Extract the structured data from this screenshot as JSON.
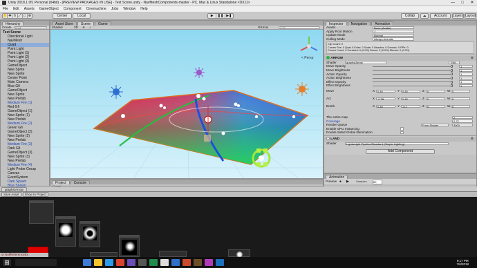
{
  "window": {
    "title": "Unity 2018.1.0f1 Personal (64bit) - [PREVIEW PACKAGES IN USE] - Test Scene.unity - NavMeshComponents-master - PC, Mac & Linux Standalone <DX11>",
    "minimize": "—",
    "maximize": "□",
    "close": "✕"
  },
  "menu": [
    "File",
    "Edit",
    "Assets",
    "GameObject",
    "Component",
    "Cinemachine",
    "Jobs",
    "Window",
    "Help"
  ],
  "toolbar": {
    "pivot": "Center",
    "space": "Local",
    "collab": "Collab",
    "account": "Account",
    "layers": "Layers",
    "layout": "Layout"
  },
  "hierarchy": {
    "tab": "Hierarchy",
    "create": "Create",
    "search_placeholder": "Q·All",
    "items": [
      {
        "label": "Test Scene",
        "kind": "scene"
      },
      {
        "label": "Directional Light",
        "kind": "normal"
      },
      {
        "label": "NavMesh",
        "kind": "normal"
      },
      {
        "label": "Quad",
        "kind": "selected"
      },
      {
        "label": "Point Light",
        "kind": "normal"
      },
      {
        "label": "Point Light (1)",
        "kind": "normal"
      },
      {
        "label": "Point Light (2)",
        "kind": "normal"
      },
      {
        "label": "Point Light (3)",
        "kind": "normal"
      },
      {
        "label": "GameObject",
        "kind": "normal"
      },
      {
        "label": "New Sprite",
        "kind": "normal"
      },
      {
        "label": "New Sprite",
        "kind": "normal"
      },
      {
        "label": "Center Point",
        "kind": "normal"
      },
      {
        "label": "Main Camera",
        "kind": "normal"
      },
      {
        "label": "Blue Gfi",
        "kind": "normal"
      },
      {
        "label": "GameObject",
        "kind": "normal"
      },
      {
        "label": "New Sprite",
        "kind": "normal"
      },
      {
        "label": "New Prefab",
        "kind": "normal"
      },
      {
        "label": "Medium Fire (1)",
        "kind": "prefab"
      },
      {
        "label": "Red Gfi",
        "kind": "normal"
      },
      {
        "label": "GameObject (1)",
        "kind": "normal"
      },
      {
        "label": "New Sprite (1)",
        "kind": "normal"
      },
      {
        "label": "New Prefab",
        "kind": "normal"
      },
      {
        "label": "Medium Fire (2)",
        "kind": "prefab"
      },
      {
        "label": "Green Gfi",
        "kind": "normal"
      },
      {
        "label": "GameObject (2)",
        "kind": "normal"
      },
      {
        "label": "New Sprite (2)",
        "kind": "normal"
      },
      {
        "label": "New Prefab",
        "kind": "normal"
      },
      {
        "label": "Medium Fire (3)",
        "kind": "prefab"
      },
      {
        "label": "Dark Gfi",
        "kind": "normal"
      },
      {
        "label": "GameObject (3)",
        "kind": "normal"
      },
      {
        "label": "New Sprite (3)",
        "kind": "normal"
      },
      {
        "label": "New Prefab",
        "kind": "normal"
      },
      {
        "label": "Medium Fire (4)",
        "kind": "prefab"
      },
      {
        "label": "Light Probe Group",
        "kind": "normal"
      },
      {
        "label": "Canvas",
        "kind": "normal"
      },
      {
        "label": "EventSystem",
        "kind": "normal"
      },
      {
        "label": "Dark Spawn",
        "kind": "blue"
      },
      {
        "label": "Blue Spawn",
        "kind": "blue"
      },
      {
        "label": "Green Spawn",
        "kind": "blue"
      },
      {
        "label": "Red Spawn",
        "kind": "blue"
      }
    ]
  },
  "scene": {
    "tabs": [
      "Asset Store",
      "Scene",
      "Game"
    ],
    "shading": "Shaded",
    "mode_2d": "2D",
    "gizmos": "Gizmos",
    "search_placeholder": "Q·All",
    "persp": "< Persp"
  },
  "inspector": {
    "tabs": [
      "Inspector",
      "Navigation",
      "Animation"
    ],
    "animator_rows": [
      {
        "label": "Avatar",
        "value": "None (Avatar)"
      },
      {
        "label": "Apply Root Motion",
        "value": "✓"
      },
      {
        "label": "Update Mode",
        "value": "Normal"
      },
      {
        "label": "Culling Mode",
        "value": "Always Animate"
      }
    ],
    "clip_info": [
      "Clip Count: 0",
      "Curves Pos: 0 Quat: 0 Euler: 0 Scale: 0 Muscles: 0 Generic: 0 PPtr: 0",
      "Curves Count: 0 Constant: 0 (0.0%) Dense: 0 (0.0%) Stream: 0 (0.0%)"
    ],
    "material1": {
      "name": "ARROW",
      "shader_label": "Shader",
      "shader": "graphs/Arrow"
    },
    "sliders": [
      {
        "label": "Move Opacity",
        "value": "1",
        "fraction": 1.0
      },
      {
        "label": "Move Brightness",
        "value": "1",
        "fraction": 1.0
      },
      {
        "label": "Action Opacity",
        "value": "1",
        "fraction": 1.0
      },
      {
        "label": "Action Brightness",
        "value": "1",
        "fraction": 1.0
      },
      {
        "label": "Effect Opacity",
        "value": "1",
        "fraction": 1.0
      },
      {
        "label": "Effect Brightness",
        "value": "1",
        "fraction": 1.0
      }
    ],
    "vectors": [
      {
        "label": "Move",
        "x": "0.45",
        "y": "0.45",
        "z": "0",
        "w": "0"
      },
      {
        "label": "Act",
        "x": "-0.38",
        "y": "0.45",
        "z": "0",
        "w": "0"
      },
      {
        "label": "Bomb",
        "x": "0.45",
        "y": "-0.1",
        "z": "0",
        "w": "0"
      }
    ],
    "entire_map": {
      "label": "The entire map",
      "value": "2"
    },
    "coverage": {
      "label": "Coverage",
      "value": "0.72"
    },
    "render_queue": {
      "label": "Render Queue",
      "from": "From Shader",
      "value": "3000"
    },
    "gpu_instancing": "Enable GPU Instancing",
    "double_sided": "Double Sided Global Illumination",
    "material2": {
      "name": "LAND",
      "shader_label": "Shader",
      "shader": "Lightweight Pipeline/Standard (Simple Lighting)"
    },
    "add_component": "Add Component"
  },
  "animation": {
    "tab": "Animation",
    "preview": "Preview",
    "samples_label": "Samples",
    "samples": "60"
  },
  "project": {
    "tabs": [
      "Project",
      "Console"
    ],
    "create": "Create"
  },
  "graph": {
    "tab": "graphs/Arrow",
    "save": "Save Asset",
    "show": "Show In Project"
  },
  "status": {
    "text": "NullReferenceEx"
  },
  "taskbar": {
    "time": "9:17 PM",
    "date": "7/6/2018"
  }
}
